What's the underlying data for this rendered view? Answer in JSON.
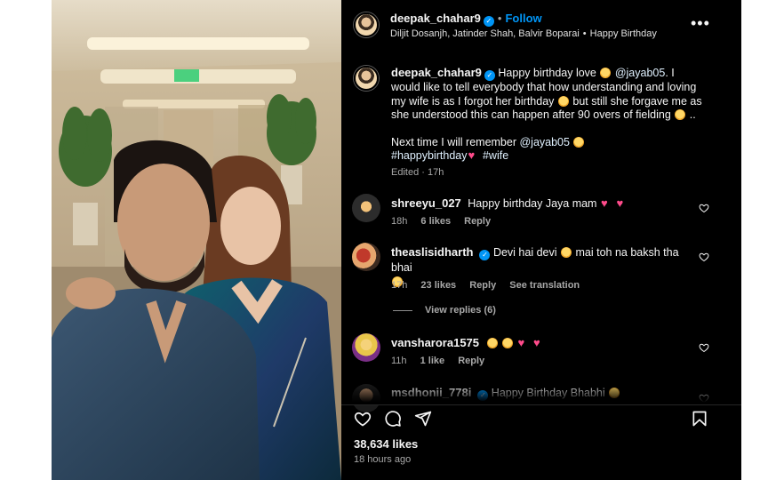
{
  "post_header": {
    "username": "deepak_chahar9",
    "follow_label": "Follow",
    "audio_line": [
      "Diljit Dosanjh, Jatinder Shah, Balvir Boparai",
      "Happy Birthday"
    ],
    "more_label": "•••"
  },
  "caption": {
    "username": "deepak_chahar9",
    "text_1": "Happy birthday love",
    "mention_1": "@jayab05",
    "text_2": ". I would like to tell everybody that how understanding and loving my wife is as I forgot her birthday",
    "text_3": "but still she forgave me as she understood this can happen after 90 overs of fielding",
    "text_4": "..",
    "text_5": "Next time I will remember",
    "mention_2": "@jayab05",
    "hashtag_1": "#happybirthday",
    "hashtag_2": "#wife",
    "meta": "Edited · 17h"
  },
  "comments": [
    {
      "username": "shreeyu_027",
      "text": "Happy birthday Jaya mam",
      "time": "18h",
      "likes": "6 likes",
      "reply_label": "Reply"
    },
    {
      "username": "theaslisidharth",
      "text_1": "Devi hai devi",
      "text_2": "mai toh na baksh tha bhai",
      "time": "17h",
      "likes": "23 likes",
      "reply_label": "Reply",
      "translation_label": "See translation",
      "view_replies": "View replies (6)"
    },
    {
      "username": "vansharora1575",
      "time": "11h",
      "likes": "1 like",
      "reply_label": "Reply"
    },
    {
      "username": "msdhonii_778i",
      "text": "Happy Birthday Bhabhi"
    }
  ],
  "footer": {
    "likes": "38,634 likes",
    "time_ago": "18 hours ago"
  },
  "colors": {
    "panel_bg": "#000000",
    "link_blue": "#0095f6",
    "secondary_text": "#a8a8a8"
  }
}
